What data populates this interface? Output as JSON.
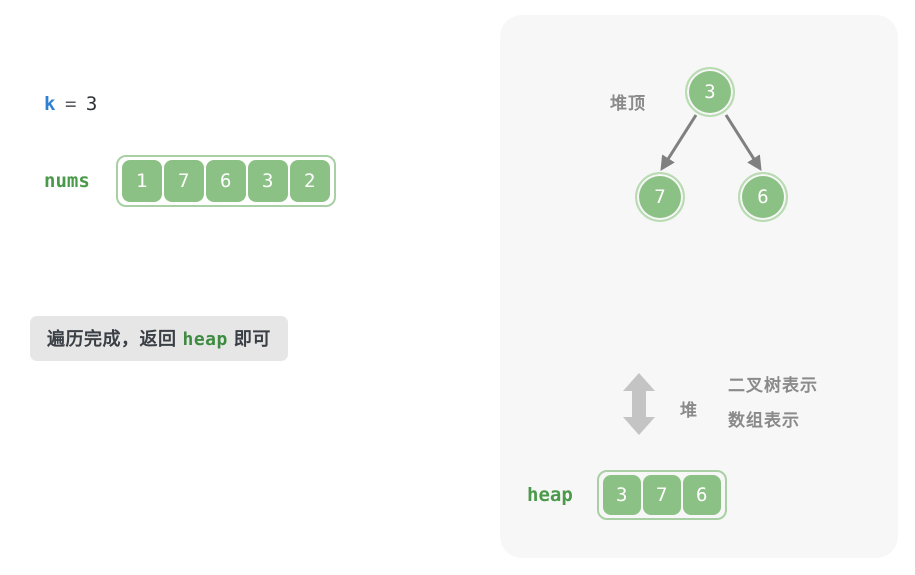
{
  "left": {
    "k_assignment": {
      "name": "k",
      "operator": "=",
      "value": "3"
    },
    "nums_array": {
      "label": "nums",
      "values": [
        "1",
        "7",
        "6",
        "3",
        "2"
      ]
    },
    "message": {
      "prefix": "遍历完成，返回",
      "code_word": "heap",
      "suffix": "即可"
    }
  },
  "panel": {
    "tree": {
      "top_label": "堆顶",
      "root": "3",
      "left_child": "7",
      "right_child": "6"
    },
    "relation": {
      "arrow_icon": "up-down-arrow-icon",
      "center_label": "堆",
      "label_top": "二叉树表示",
      "label_bottom": "数组表示"
    },
    "heap_array": {
      "label": "heap",
      "values": [
        "3",
        "7",
        "6"
      ]
    }
  },
  "colors": {
    "cell_fill": "#8cc185",
    "cell_border": "#a9cfa4",
    "code_green": "#4a9a4a",
    "accent_blue": "#2f80d0",
    "gray_text": "#8a8a8a",
    "panel_bg": "#f7f7f7",
    "bubble_bg": "#e6e6e6",
    "arrow_gray": "#808080",
    "icon_gray": "#c4c4c4"
  }
}
